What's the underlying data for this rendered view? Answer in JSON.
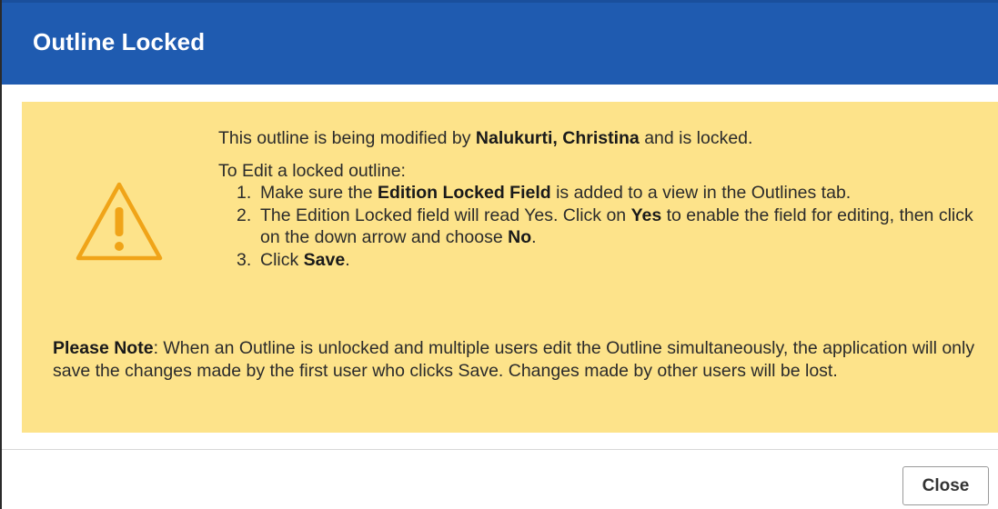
{
  "dialog": {
    "title": "Outline Locked",
    "alert": {
      "icon": "warning-triangle-icon",
      "line1_prefix": "This outline is being modified by ",
      "locked_by": "Nalukurti, Christina",
      "line1_suffix": " and is locked.",
      "instructions_heading": "To Edit a locked outline:",
      "steps": [
        {
          "num": "1.",
          "part1": "Make sure the ",
          "bold1": "Edition Locked Field",
          "part2": " is added to a view in the Outlines tab."
        },
        {
          "num": "2.",
          "part1": "The Edition Locked field will read Yes. Click on ",
          "bold1": "Yes",
          "part2": " to enable the field for editing, then click on the down arrow and choose ",
          "bold2": "No",
          "part3": "."
        },
        {
          "num": "3.",
          "part1": "Click ",
          "bold1": "Save",
          "part2": "."
        }
      ],
      "note_label": "Please Note",
      "note_text": ": When an Outline is unlocked and multiple users edit the Outline simultaneously, the application will only save the changes made by the first user who clicks Save. Changes made by other users will be lost."
    },
    "footer": {
      "close_label": "Close"
    }
  },
  "colors": {
    "header_bg": "#1f5bb0",
    "alert_bg": "#fde38a",
    "warning_icon": "#f0a418"
  }
}
